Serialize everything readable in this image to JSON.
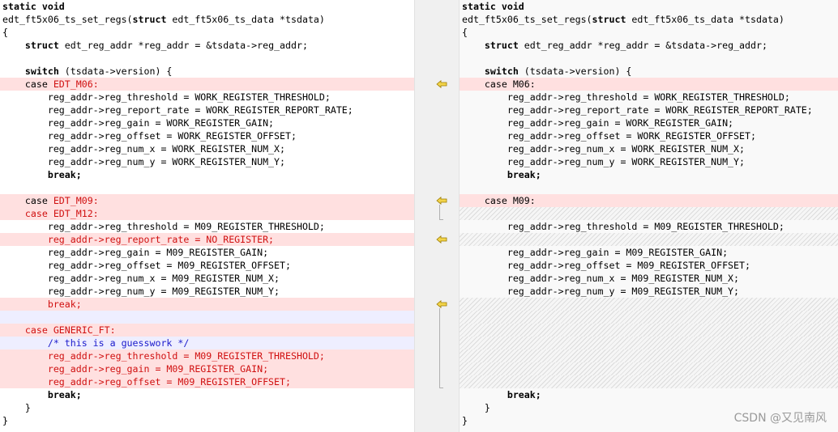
{
  "left": {
    "lines": [
      {
        "bg": "",
        "segs": [
          {
            "t": "static void",
            "s": "kw"
          }
        ]
      },
      {
        "bg": "",
        "segs": [
          {
            "t": "edt_ft5x06_ts_set_regs("
          },
          {
            "t": "struct",
            "s": "kw"
          },
          {
            "t": " edt_ft5x06_ts_data *tsdata)"
          }
        ]
      },
      {
        "bg": "",
        "segs": [
          {
            "t": "{"
          }
        ]
      },
      {
        "bg": "",
        "segs": [
          {
            "t": "    "
          },
          {
            "t": "struct",
            "s": "kw"
          },
          {
            "t": " edt_reg_addr *reg_addr = &tsdata->reg_addr;"
          }
        ]
      },
      {
        "bg": "",
        "segs": []
      },
      {
        "bg": "",
        "segs": [
          {
            "t": "    "
          },
          {
            "t": "switch",
            "s": "kw"
          },
          {
            "t": " (tsdata->version) {"
          }
        ]
      },
      {
        "bg": "removed",
        "segs": [
          {
            "t": "    case "
          },
          {
            "t": "EDT_M06:",
            "s": "red"
          }
        ]
      },
      {
        "bg": "",
        "segs": [
          {
            "t": "        reg_addr->reg_threshold = WORK_REGISTER_THRESHOLD;"
          }
        ]
      },
      {
        "bg": "",
        "segs": [
          {
            "t": "        reg_addr->reg_report_rate = WORK_REGISTER_REPORT_RATE;"
          }
        ]
      },
      {
        "bg": "",
        "segs": [
          {
            "t": "        reg_addr->reg_gain = WORK_REGISTER_GAIN;"
          }
        ]
      },
      {
        "bg": "",
        "segs": [
          {
            "t": "        reg_addr->reg_offset = WORK_REGISTER_OFFSET;"
          }
        ]
      },
      {
        "bg": "",
        "segs": [
          {
            "t": "        reg_addr->reg_num_x = WORK_REGISTER_NUM_X;"
          }
        ]
      },
      {
        "bg": "",
        "segs": [
          {
            "t": "        reg_addr->reg_num_y = WORK_REGISTER_NUM_Y;"
          }
        ]
      },
      {
        "bg": "",
        "segs": [
          {
            "t": "        "
          },
          {
            "t": "break;",
            "s": "kw"
          }
        ]
      },
      {
        "bg": "",
        "segs": []
      },
      {
        "bg": "removed",
        "segs": [
          {
            "t": "    case "
          },
          {
            "t": "EDT_M09:",
            "s": "red"
          }
        ]
      },
      {
        "bg": "removed",
        "segs": [
          {
            "t": "    case EDT_M12:",
            "s": "red"
          }
        ]
      },
      {
        "bg": "",
        "segs": [
          {
            "t": "        reg_addr->reg_threshold = M09_REGISTER_THRESHOLD;"
          }
        ]
      },
      {
        "bg": "removed",
        "segs": [
          {
            "t": "        reg_addr->reg_report_rate = NO_REGISTER;",
            "s": "red"
          }
        ]
      },
      {
        "bg": "",
        "segs": [
          {
            "t": "        reg_addr->reg_gain = M09_REGISTER_GAIN;"
          }
        ]
      },
      {
        "bg": "",
        "segs": [
          {
            "t": "        reg_addr->reg_offset = M09_REGISTER_OFFSET;"
          }
        ]
      },
      {
        "bg": "",
        "segs": [
          {
            "t": "        reg_addr->reg_num_x = M09_REGISTER_NUM_X;"
          }
        ]
      },
      {
        "bg": "",
        "segs": [
          {
            "t": "        reg_addr->reg_num_y = M09_REGISTER_NUM_Y;"
          }
        ]
      },
      {
        "bg": "removed",
        "segs": [
          {
            "t": "        break;",
            "s": "red"
          }
        ]
      },
      {
        "bg": "blank",
        "segs": []
      },
      {
        "bg": "removed",
        "segs": [
          {
            "t": "    case GENERIC_FT:",
            "s": "red"
          }
        ]
      },
      {
        "bg": "blank",
        "segs": [
          {
            "t": "        /* this is a guesswork */",
            "s": "blue"
          }
        ]
      },
      {
        "bg": "removed",
        "segs": [
          {
            "t": "        reg_addr->reg_threshold = M09_REGISTER_THRESHOLD;",
            "s": "red"
          }
        ]
      },
      {
        "bg": "removed",
        "segs": [
          {
            "t": "        reg_addr->reg_gain = M09_REGISTER_GAIN;",
            "s": "red"
          }
        ]
      },
      {
        "bg": "removed",
        "segs": [
          {
            "t": "        reg_addr->reg_offset = M09_REGISTER_OFFSET;",
            "s": "red"
          }
        ]
      },
      {
        "bg": "",
        "segs": [
          {
            "t": "        "
          },
          {
            "t": "break;",
            "s": "kw"
          }
        ]
      },
      {
        "bg": "",
        "segs": [
          {
            "t": "    }"
          }
        ]
      },
      {
        "bg": "",
        "segs": [
          {
            "t": "}"
          }
        ]
      }
    ]
  },
  "right": {
    "lines": [
      {
        "bg": "",
        "segs": [
          {
            "t": "static void",
            "s": "kw"
          }
        ]
      },
      {
        "bg": "",
        "segs": [
          {
            "t": "edt_ft5x06_ts_set_regs("
          },
          {
            "t": "struct",
            "s": "kw"
          },
          {
            "t": " edt_ft5x06_ts_data *tsdata)"
          }
        ]
      },
      {
        "bg": "",
        "segs": [
          {
            "t": "{"
          }
        ]
      },
      {
        "bg": "",
        "segs": [
          {
            "t": "    "
          },
          {
            "t": "struct",
            "s": "kw"
          },
          {
            "t": " edt_reg_addr *reg_addr = &tsdata->reg_addr;"
          }
        ]
      },
      {
        "bg": "",
        "segs": []
      },
      {
        "bg": "",
        "segs": [
          {
            "t": "    "
          },
          {
            "t": "switch",
            "s": "kw"
          },
          {
            "t": " (tsdata->version) {"
          }
        ]
      },
      {
        "bg": "removed",
        "segs": [
          {
            "t": "    case M06:"
          }
        ]
      },
      {
        "bg": "",
        "segs": [
          {
            "t": "        reg_addr->reg_threshold = WORK_REGISTER_THRESHOLD;"
          }
        ]
      },
      {
        "bg": "",
        "segs": [
          {
            "t": "        reg_addr->reg_report_rate = WORK_REGISTER_REPORT_RATE;"
          }
        ]
      },
      {
        "bg": "",
        "segs": [
          {
            "t": "        reg_addr->reg_gain = WORK_REGISTER_GAIN;"
          }
        ]
      },
      {
        "bg": "",
        "segs": [
          {
            "t": "        reg_addr->reg_offset = WORK_REGISTER_OFFSET;"
          }
        ]
      },
      {
        "bg": "",
        "segs": [
          {
            "t": "        reg_addr->reg_num_x = WORK_REGISTER_NUM_X;"
          }
        ]
      },
      {
        "bg": "",
        "segs": [
          {
            "t": "        reg_addr->reg_num_y = WORK_REGISTER_NUM_Y;"
          }
        ]
      },
      {
        "bg": "",
        "segs": [
          {
            "t": "        "
          },
          {
            "t": "break;",
            "s": "kw"
          }
        ]
      },
      {
        "bg": "",
        "segs": []
      },
      {
        "bg": "removed",
        "segs": [
          {
            "t": "    case M09:"
          }
        ]
      },
      {
        "bg": "hatch",
        "segs": []
      },
      {
        "bg": "",
        "segs": [
          {
            "t": "        reg_addr->reg_threshold = M09_REGISTER_THRESHOLD;"
          }
        ]
      },
      {
        "bg": "hatch",
        "segs": []
      },
      {
        "bg": "",
        "segs": [
          {
            "t": "        reg_addr->reg_gain = M09_REGISTER_GAIN;"
          }
        ]
      },
      {
        "bg": "",
        "segs": [
          {
            "t": "        reg_addr->reg_offset = M09_REGISTER_OFFSET;"
          }
        ]
      },
      {
        "bg": "",
        "segs": [
          {
            "t": "        reg_addr->reg_num_x = M09_REGISTER_NUM_X;"
          }
        ]
      },
      {
        "bg": "",
        "segs": [
          {
            "t": "        reg_addr->reg_num_y = M09_REGISTER_NUM_Y;"
          }
        ]
      },
      {
        "bg": "hatch",
        "segs": []
      },
      {
        "bg": "hatch",
        "segs": []
      },
      {
        "bg": "hatch",
        "segs": []
      },
      {
        "bg": "hatch",
        "segs": []
      },
      {
        "bg": "hatch",
        "segs": []
      },
      {
        "bg": "hatch",
        "segs": []
      },
      {
        "bg": "hatch",
        "segs": []
      },
      {
        "bg": "",
        "segs": [
          {
            "t": "        "
          },
          {
            "t": "break;",
            "s": "kw"
          }
        ]
      },
      {
        "bg": "",
        "segs": [
          {
            "t": "    }"
          }
        ]
      },
      {
        "bg": "",
        "segs": [
          {
            "t": "}"
          }
        ]
      }
    ]
  },
  "gutter": {
    "arrow_icon": "merge-arrow-left-icon",
    "arrow_fill": "#f2d44a",
    "arrow_stroke": "#9c7b00",
    "markers": [
      {
        "line": 6,
        "span": 1
      },
      {
        "line": 15,
        "span": 2
      },
      {
        "line": 18,
        "span": 1
      },
      {
        "line": 23,
        "span": 7
      }
    ]
  },
  "colors": {
    "removed_bg": "#ffe0e0",
    "blank_bg": "#eeeeff",
    "removed_text": "#d01010",
    "comment_text": "#1a1acc"
  },
  "watermark": "CSDN @又见南风"
}
